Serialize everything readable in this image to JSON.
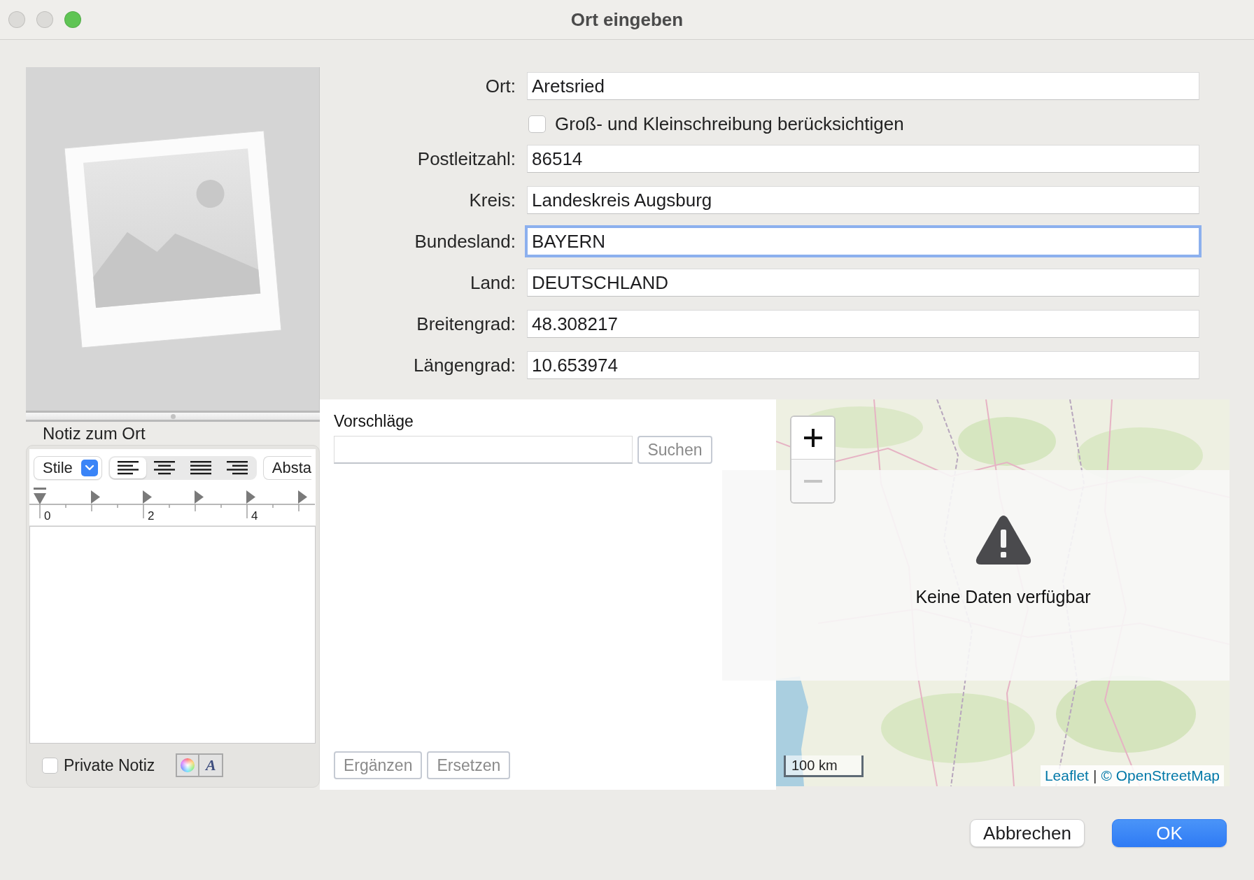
{
  "window": {
    "title": "Ort eingeben",
    "controls": [
      {
        "kind": "close",
        "enabled": false
      },
      {
        "kind": "minimize",
        "enabled": false
      },
      {
        "kind": "zoom",
        "enabled": true
      }
    ]
  },
  "form": {
    "rows": [
      {
        "kind": "field",
        "label": "Ort:",
        "value": "Aretsried",
        "focused": false
      },
      {
        "kind": "checkbox",
        "label": "Groß- und Kleinschreibung berücksichtigen",
        "checked": false
      },
      {
        "kind": "field",
        "label": "Postleitzahl:",
        "value": "86514",
        "focused": false
      },
      {
        "kind": "field",
        "label": "Kreis:",
        "value": "Landeskreis Augsburg",
        "focused": false
      },
      {
        "kind": "field",
        "label": "Bundesland:",
        "value": "BAYERN",
        "focused": true
      },
      {
        "kind": "field",
        "label": "Land:",
        "value": "DEUTSCHLAND",
        "focused": false
      },
      {
        "kind": "field",
        "label": "Breitengrad:",
        "value": "48.308217",
        "focused": false
      },
      {
        "kind": "field",
        "label": "Längengrad:",
        "value": "10.653974",
        "focused": false
      }
    ]
  },
  "note": {
    "title": "Notiz zum Ort",
    "toolbar": {
      "style_menu": "Stile",
      "alignments": [
        {
          "kind": "left",
          "selected": true
        },
        {
          "kind": "center",
          "selected": false
        },
        {
          "kind": "justify",
          "selected": false
        },
        {
          "kind": "right",
          "selected": false
        }
      ],
      "spacing_button": "Absta"
    },
    "ruler": {
      "labels": [
        "0",
        "2",
        "4"
      ]
    },
    "private": {
      "label": "Private Notiz",
      "checked": false
    },
    "font_button": "A"
  },
  "suggestions": {
    "title": "Vorschläge",
    "search_button": {
      "label": "Suchen",
      "disabled": true
    },
    "actions": [
      {
        "label": "Ergänzen",
        "disabled": true
      },
      {
        "label": "Ersetzen",
        "disabled": true
      }
    ]
  },
  "map": {
    "message": "Keine Daten verfügbar",
    "scale": "100 km",
    "attribution": {
      "links": [
        "Leaflet",
        "© OpenStreetMap"
      ],
      "separator": "|"
    }
  },
  "buttons": [
    {
      "label": "Abbrechen",
      "default": false
    },
    {
      "label": "OK",
      "default": true
    }
  ]
}
